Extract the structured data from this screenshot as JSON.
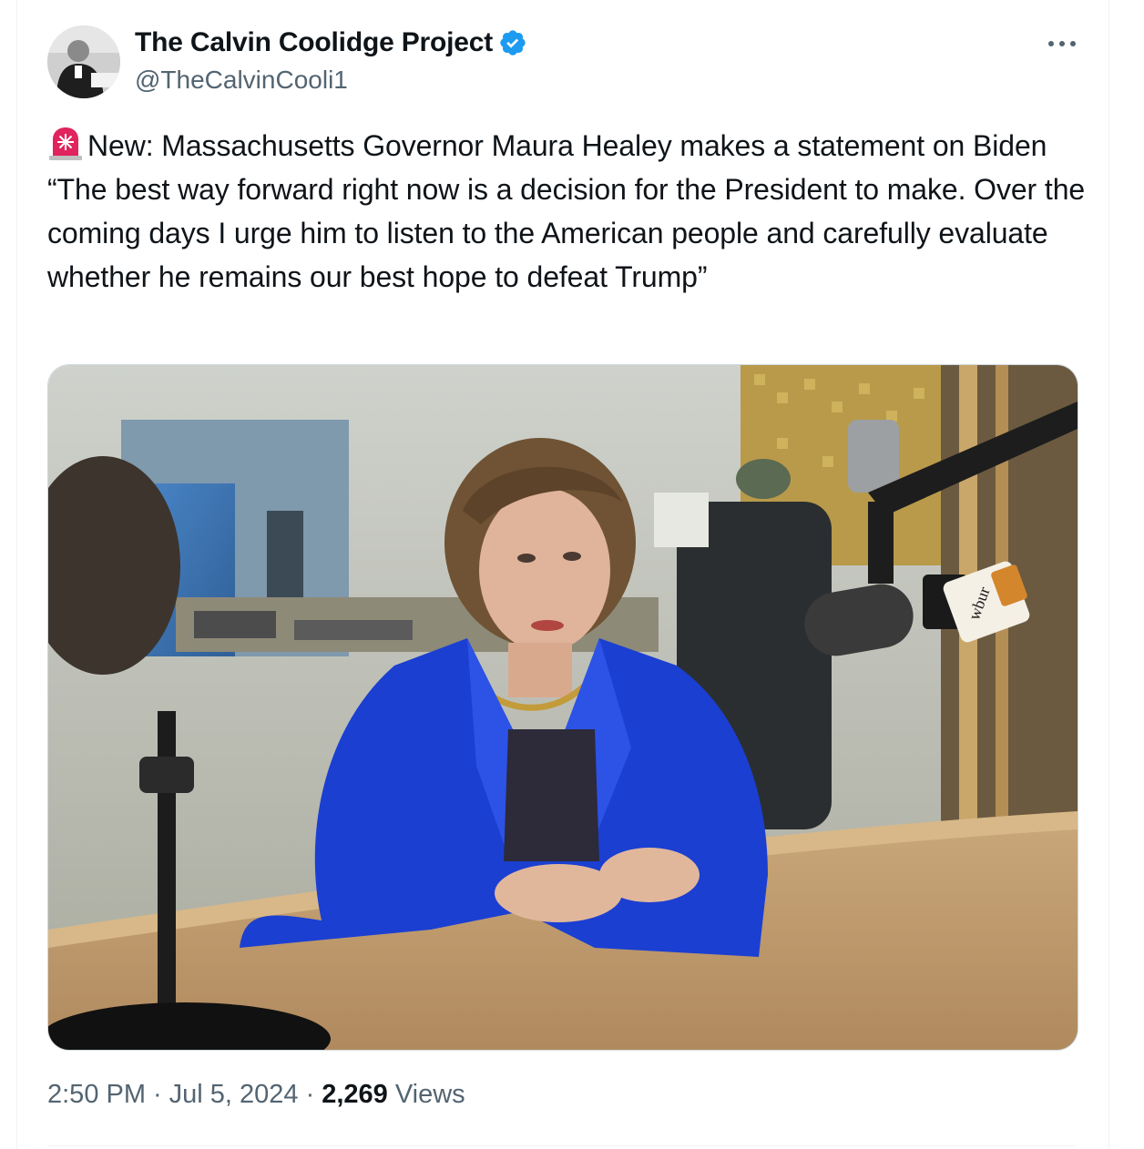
{
  "author": {
    "display_name": "The Calvin Coolidge Project",
    "handle": "@TheCalvinCooli1",
    "verified_color": "#1d9bf0"
  },
  "tweet": {
    "emoji": "siren-icon",
    "text": "New: Massachusetts Governor Maura Healey makes a statement on Biden “The best way forward right now is a decision for the President to make. Over the coming days I urge him to listen to the American people and carefully evaluate whether he remains our best hope to defeat Trump”"
  },
  "media": {
    "type": "photo",
    "mic_label": "wbur"
  },
  "meta": {
    "time": "2:50 PM",
    "separator": "·",
    "date": "Jul 5, 2024",
    "views_count": "2,269",
    "views_label": "Views"
  },
  "colors": {
    "text": "#0f1419",
    "secondary": "#536471",
    "accent": "#1d9bf0",
    "border": "#cfd9de"
  }
}
